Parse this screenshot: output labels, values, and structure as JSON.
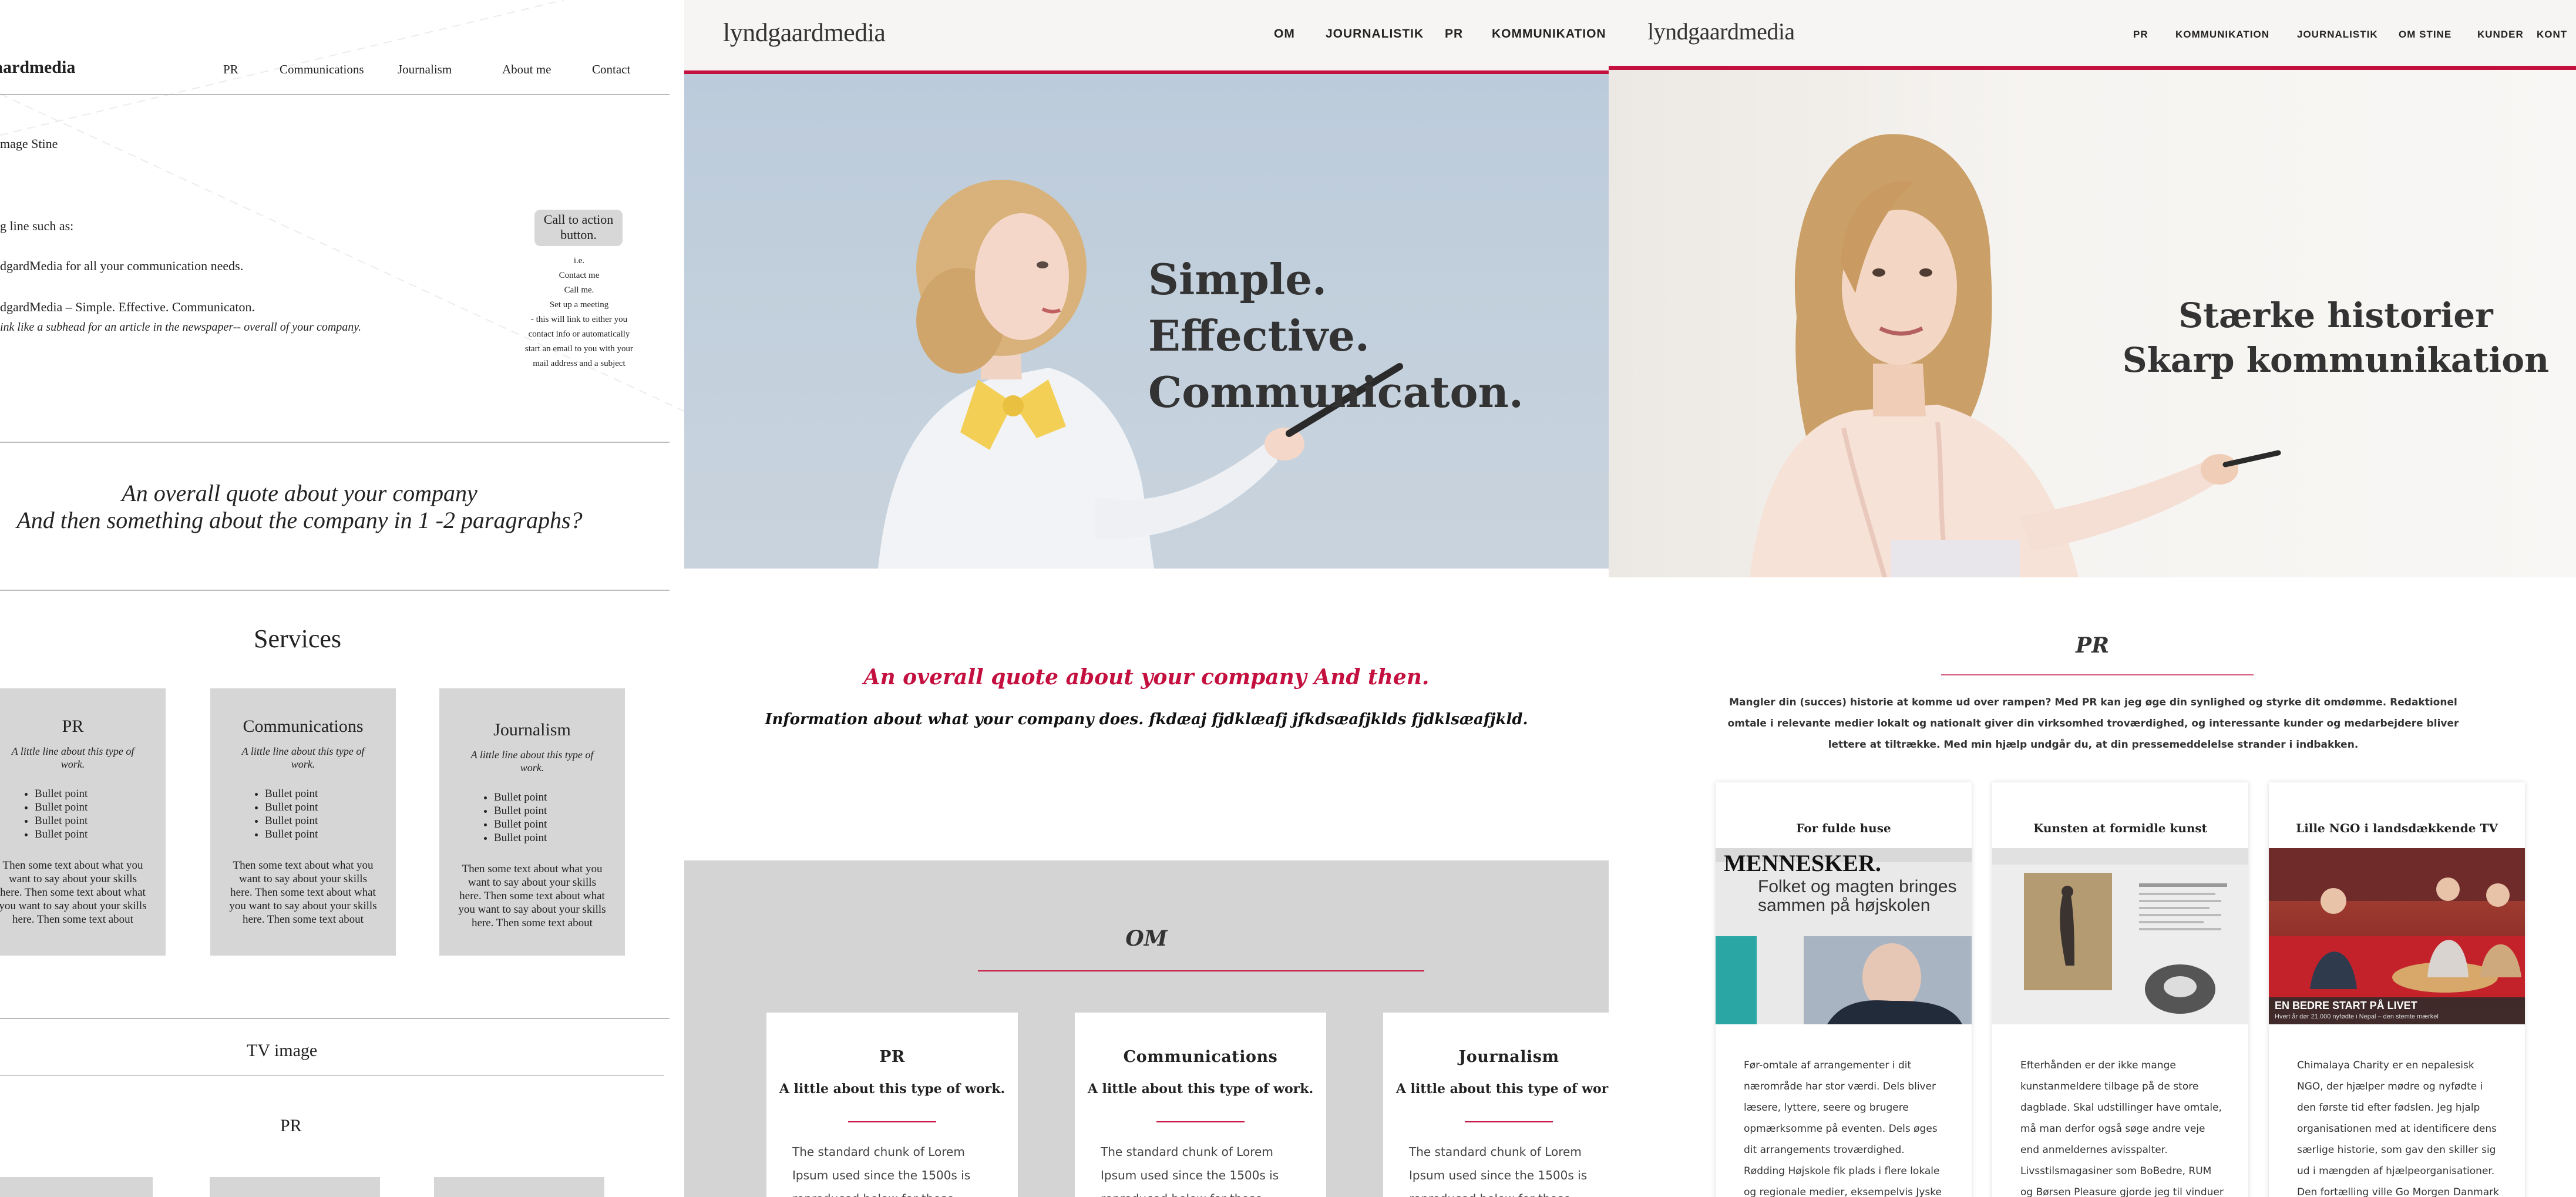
{
  "wireframe": {
    "logo": "aardmedia",
    "nav": [
      "PR",
      "Communications",
      "Journalism",
      "About me",
      "Contact"
    ],
    "image_caption": "mage Stine",
    "line_intro": "g line such as:",
    "line_1": "dgardMedia for all your communication needs.",
    "line_2": "dgardMedia – Simple. Effective. Communicaton.",
    "line_3": "ink like a subhead for an article in the newspaper-- overall of your company.",
    "cta_button": "Call to action button.",
    "cta_notes": [
      "i.e.",
      "Contact me",
      "Call me.",
      "Set up a meeting",
      "- this will link to either you",
      "contact info or automatically",
      "start an email to you with your",
      "mail address and a subject"
    ],
    "quote_line_1": "An overall quote about your company",
    "quote_line_2": "And then something about the company in 1 -2 paragraphs?",
    "services_heading": "Services",
    "services": [
      {
        "title": "PR",
        "sub": "A little line about this type of work.",
        "bullets": [
          "Bullet point",
          "Bullet point",
          "Bullet point",
          "Bullet point"
        ],
        "body": "Then some text about what you want to say about your skills here. Then some text about what you want to say about your skills here. Then some text about"
      },
      {
        "title": "Communications",
        "sub": "A little line about this type of work.",
        "bullets": [
          "Bullet point",
          "Bullet point",
          "Bullet point",
          "Bullet point"
        ],
        "body": "Then some text about what you want to say about your skills here. Then some text about what you want to say about your skills here. Then some text about"
      },
      {
        "title": "Journalism",
        "sub": "A little line about this type of work.",
        "bullets": [
          "Bullet point",
          "Bullet point",
          "Bullet point",
          "Bullet point"
        ],
        "body": "Then some text about what you want to say about your skills here. Then some text about what you want to say about your skills here. Then some text about"
      }
    ],
    "tv_heading": "TV image",
    "pr_heading": "PR"
  },
  "draft": {
    "logo_light": "lyndgaard",
    "logo_bold": "media",
    "nav": [
      "OM",
      "JOURNALISTIK",
      "PR",
      "KOMMUNIKATION"
    ],
    "hero_lines": [
      "Simple.",
      "Effective.",
      "Communicaton."
    ],
    "quote": "An overall quote about your company And then.",
    "info": "Information about what your company does. fkdæaj fjdklæafj jfkdsæafjklds fjdklsæafjkld.",
    "section_title": "OM",
    "cards": [
      {
        "title": "PR",
        "sub": "A little about this type of work.",
        "body": "The standard chunk of Lorem Ipsum used since the 1500s is reproduced below for those interested. Sections"
      },
      {
        "title": "Communications",
        "sub": "A little about this type of work.",
        "body": "The standard chunk of Lorem Ipsum used since the 1500s is reproduced below for those interested. Sections"
      },
      {
        "title": "Journalism",
        "sub": "A little about this type of work.",
        "body": "The standard chunk of Lorem Ipsum used since the 1500s is reproduced below for those interested. Sections"
      }
    ],
    "accent": "#c4103f"
  },
  "final": {
    "logo_light": "lyndgaard",
    "logo_bold": "media",
    "nav": [
      "PR",
      "KOMMUNIKATION",
      "JOURNALISTIK",
      "OM STINE",
      "KUNDER",
      "KONT"
    ],
    "hero_line_1": "Stærke historier",
    "hero_line_2": "Skarp kommunikation",
    "section_title": "PR",
    "intro": "Mangler din (succes) historie at komme ud over rampen? Med PR kan jeg øge din synlighed og styrke dit omdømme. Redaktionel omtale i relevante medier lokalt og nationalt giver din virksomhed troværdighed, og interessante kunder og medarbejdere bliver lettere at tiltrække. Med min hjælp undgår du, at din pressemeddelelse strander i indbakken.",
    "cards": [
      {
        "title": "For fulde huse",
        "image_headline": "MENNESKER.",
        "image_sub": "Folket og magten bringes sammen på højskolen",
        "body": "Før-omtale af arrangementer i dit nærområde har stor værdi. Dels bliver læsere, lyttere, seere og brugere opmærksomme på eventen. Dels øges dit arrangements troværdighed. Rødding Højskole fik plads i flere lokale og regionale medier, eksempelvis Jyske"
      },
      {
        "title": "Kunsten at formidle kunst",
        "body": "Efterhånden er der ikke mange kunstanmeldere tilbage på de store dagblade. Skal udstillinger have omtale, må man derfor også søge andre veje end anmeldernes avisspalter. Livsstilsmagasiner som BoBedre, RUM og Børsen Pleasure gjorde jeg til vinduer for"
      },
      {
        "title": "Lille NGO i landsdækkende TV",
        "image_caption": "EN BEDRE START PÅ LIVET",
        "image_subcaption": "Hvert år dør 21.000 nyfødte i Nepal – den stemte mærkel",
        "body": "Chimalaya Charity er en nepalesisk NGO, der hjælper mødre og nyfødte i den første tid efter fødslen. Jeg hjalp organisationen med at identificere dens særlige historie, som gav den skiller sig ud i mængden af hjælpeorganisationer. Den fortælling ville Go Morgen Danmark gerne formidle."
      }
    ]
  }
}
